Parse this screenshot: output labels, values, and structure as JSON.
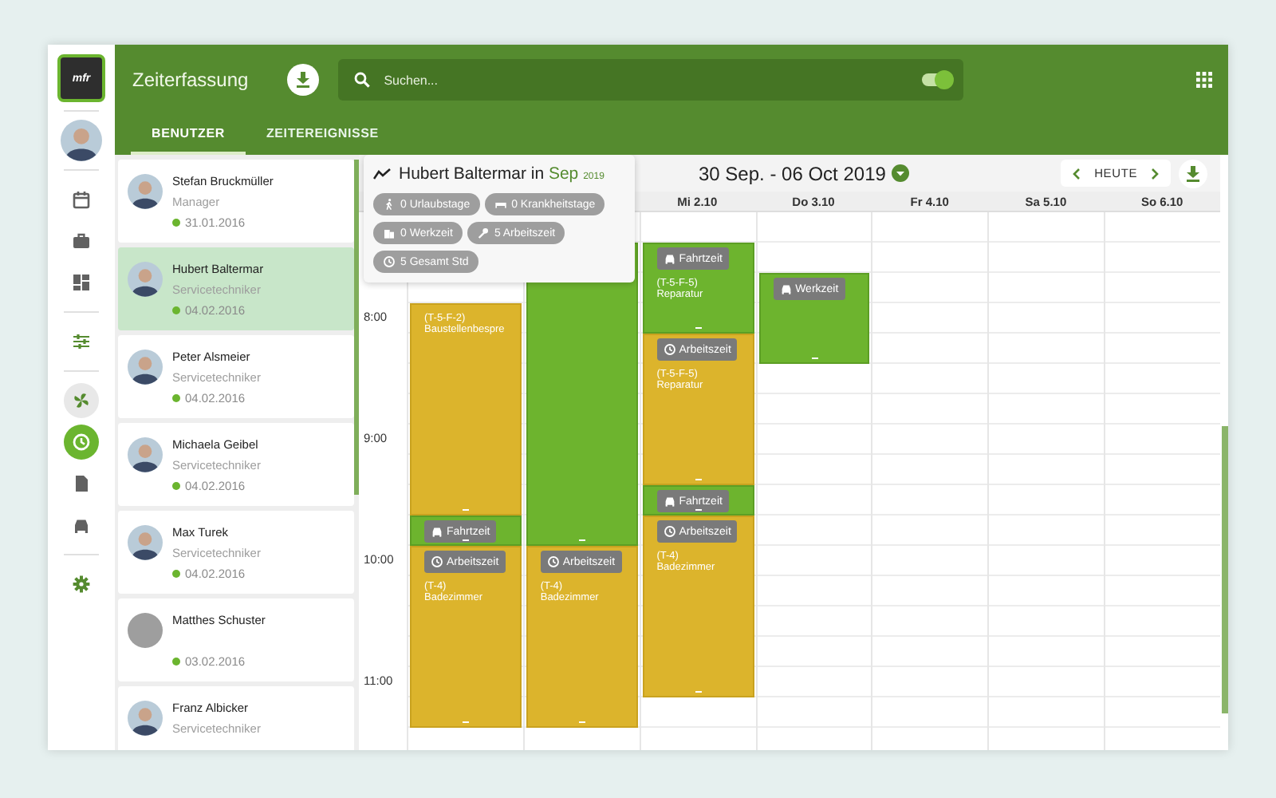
{
  "rail": {
    "logo": "mfr",
    "groups": [
      [
        {
          "kind": "calendar",
          "selected": false,
          "hovered": false
        },
        {
          "kind": "briefcase",
          "selected": false,
          "hovered": false
        },
        {
          "kind": "dashboard",
          "selected": false,
          "hovered": false
        }
      ],
      [
        {
          "kind": "sliders",
          "selected": false,
          "hovered": false
        }
      ],
      [
        {
          "kind": "fan",
          "selected": false,
          "hovered": true
        },
        {
          "kind": "clock",
          "selected": true,
          "hovered": false
        },
        {
          "kind": "document",
          "selected": false,
          "hovered": false
        },
        {
          "kind": "car",
          "selected": false,
          "hovered": false
        }
      ],
      [
        {
          "kind": "gear",
          "selected": false,
          "hovered": false
        }
      ]
    ]
  },
  "header": {
    "title": "Zeiterfassung",
    "search": {
      "placeholder": "Suchen..."
    },
    "toggle": {
      "on": true
    }
  },
  "tabs": [
    {
      "label": "BENUTZER",
      "selected": true
    },
    {
      "label": "ZEITEREIGNISSE",
      "selected": false
    }
  ],
  "users": [
    {
      "kind": "photo",
      "name": "Stefan Bruckmüller",
      "role": "Manager",
      "date": "31.01.2016",
      "selected": false
    },
    {
      "kind": "photo",
      "name": "Hubert Baltermar",
      "role": "Servicetechniker",
      "date": "04.02.2016",
      "selected": true
    },
    {
      "kind": "photo",
      "name": "Peter Alsmeier",
      "role": "Servicetechniker",
      "date": "04.02.2016",
      "selected": false
    },
    {
      "kind": "photo",
      "name": "Michaela Geibel",
      "role": "Servicetechniker",
      "date": "04.02.2016",
      "selected": false
    },
    {
      "kind": "photo",
      "name": "Max Turek",
      "role": "Servicetechniker",
      "date": "04.02.2016",
      "selected": false
    },
    {
      "kind": "blank",
      "name": "Matthes Schuster",
      "date": "03.02.2016",
      "selected": false
    },
    {
      "kind": "photo",
      "name": "Franz Albicker",
      "role": "Servicetechniker",
      "selected": false
    }
  ],
  "summary": {
    "title": "Hubert Baltermar in",
    "month": "Sep",
    "year": "2019",
    "chips": [
      {
        "kind": "walk",
        "label": "0 Urlaubstage"
      },
      {
        "kind": "bed",
        "label": "0 Krankheitstage"
      },
      {
        "kind": "building",
        "label": "0 Werkzeit"
      },
      {
        "kind": "wrench",
        "label": "5 Arbeitszeit"
      },
      {
        "kind": "clock",
        "label": "5 Gesamt Std"
      }
    ]
  },
  "calendar": {
    "range": "30 Sep. - 06 Oct 2019",
    "today": "HEUTE",
    "hours": [
      "8:00",
      "9:00",
      "10:00",
      "11:00"
    ],
    "days": [
      {
        "slots": [
          {
            "kind": "free"
          },
          {
            "kind": "free"
          },
          {
            "kind": "free"
          },
          {
            "kind": "start"
          },
          {
            "kind": "busy"
          },
          {
            "kind": "busy"
          },
          {
            "kind": "busy"
          },
          {
            "kind": "busy"
          },
          {
            "kind": "busy"
          },
          {
            "kind": "busy"
          },
          {
            "kind": "start"
          },
          {
            "kind": "start"
          },
          {
            "kind": "busy"
          },
          {
            "kind": "busy"
          },
          {
            "kind": "busy"
          },
          {
            "kind": "busy"
          },
          {
            "kind": "busy"
          }
        ],
        "events": [
          {
            "kind": "work",
            "lines": [
              "(T-5-F-2)",
              "Baustellenbespre"
            ]
          },
          {
            "kind": "travel",
            "badge": {
              "kind": "car",
              "label": "Fahrtzeit"
            }
          },
          {
            "kind": "work",
            "badge": {
              "kind": "clock",
              "label": "Arbeitszeit"
            },
            "lines": [
              "(T-4)",
              "Badezimmer"
            ]
          }
        ]
      },
      {
        "slots": [
          {
            "kind": "free"
          },
          {
            "kind": "start"
          },
          {
            "kind": "busy"
          },
          {
            "kind": "busy"
          },
          {
            "kind": "busy"
          },
          {
            "kind": "busy"
          },
          {
            "kind": "busy"
          },
          {
            "kind": "busy"
          },
          {
            "kind": "busy"
          },
          {
            "kind": "busy"
          },
          {
            "kind": "busy"
          },
          {
            "kind": "start"
          },
          {
            "kind": "busy"
          },
          {
            "kind": "busy"
          },
          {
            "kind": "busy"
          },
          {
            "kind": "busy"
          },
          {
            "kind": "busy"
          }
        ],
        "events": [
          {
            "kind": "travel"
          },
          {
            "kind": "work",
            "badge": {
              "kind": "clock",
              "label": "Arbeitszeit"
            },
            "lines": [
              "(T-4)",
              "Badezimmer"
            ]
          }
        ]
      },
      {
        "label": "Mi 2.10",
        "slots": [
          {
            "kind": "free"
          },
          {
            "kind": "start"
          },
          {
            "kind": "busy"
          },
          {
            "kind": "busy"
          },
          {
            "kind": "start"
          },
          {
            "kind": "busy"
          },
          {
            "kind": "busy"
          },
          {
            "kind": "busy"
          },
          {
            "kind": "busy"
          },
          {
            "kind": "start"
          },
          {
            "kind": "start"
          },
          {
            "kind": "busy"
          },
          {
            "kind": "busy"
          },
          {
            "kind": "busy"
          },
          {
            "kind": "busy"
          },
          {
            "kind": "busy"
          }
        ],
        "events": [
          {
            "kind": "travel",
            "badge": {
              "kind": "car",
              "label": "Fahrtzeit"
            },
            "lines": [
              "(T-5-F-5)",
              "Reparatur"
            ]
          },
          {
            "kind": "work",
            "badge": {
              "kind": "clock",
              "label": "Arbeitszeit"
            },
            "lines": [
              "(T-5-F-5)",
              "Reparatur"
            ]
          },
          {
            "kind": "travel",
            "badge": {
              "kind": "car",
              "label": "Fahrtzeit"
            }
          },
          {
            "kind": "work",
            "badge": {
              "kind": "clock",
              "label": "Arbeitszeit"
            },
            "lines": [
              "(T-4)",
              "Badezimmer"
            ]
          }
        ]
      },
      {
        "label": "Do 3.10",
        "slots": [
          {
            "kind": "free"
          },
          {
            "kind": "free"
          },
          {
            "kind": "start"
          },
          {
            "kind": "busy"
          },
          {
            "kind": "busy"
          }
        ],
        "events": [
          {
            "kind": "travel",
            "badge": {
              "kind": "car",
              "label": "Werkzeit"
            }
          }
        ]
      },
      {
        "label": "Fr 4.10"
      },
      {
        "label": "Sa 5.10"
      },
      {
        "label": "So 6.10"
      }
    ]
  }
}
